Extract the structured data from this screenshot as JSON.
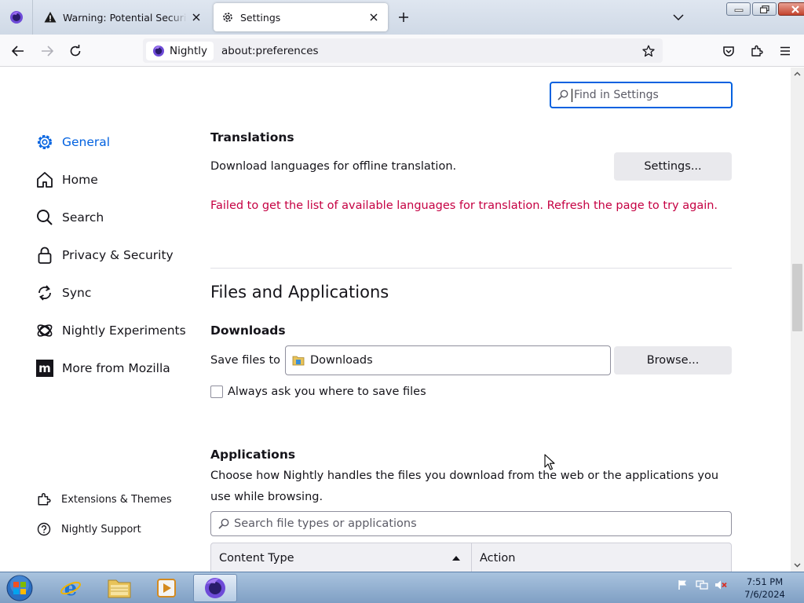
{
  "tabs": [
    {
      "title": "Warning: Potential Security Risk Ahead",
      "icon": "warning-icon"
    },
    {
      "title": "Settings",
      "icon": "gear-icon"
    }
  ],
  "navbar": {
    "identity_label": "Nightly",
    "url": "about:preferences"
  },
  "search": {
    "placeholder": "Find in Settings"
  },
  "sidebar": {
    "items": [
      {
        "label": "General",
        "icon": "gear-icon",
        "selected": true
      },
      {
        "label": "Home",
        "icon": "home-icon"
      },
      {
        "label": "Search",
        "icon": "search-icon"
      },
      {
        "label": "Privacy & Security",
        "icon": "lock-icon"
      },
      {
        "label": "Sync",
        "icon": "sync-icon"
      },
      {
        "label": "Nightly Experiments",
        "icon": "experiments-icon"
      },
      {
        "label": "More from Mozilla",
        "icon": "mozilla-icon"
      }
    ],
    "footer": [
      {
        "label": "Extensions & Themes",
        "icon": "puzzle-icon"
      },
      {
        "label": "Nightly Support",
        "icon": "help-icon"
      }
    ]
  },
  "translations": {
    "heading": "Translations",
    "description": "Download languages for offline translation.",
    "settings_button": "Settings...",
    "error": "Failed to get the list of available languages for translation. Refresh the page to try again."
  },
  "files_apps": {
    "heading": "Files and Applications",
    "downloads": {
      "heading": "Downloads",
      "save_label": "Save files to",
      "folder": "Downloads",
      "browse_button": "Browse...",
      "always_ask": "Always ask you where to save files",
      "always_ask_checked": false
    },
    "applications": {
      "heading": "Applications",
      "description": "Choose how Nightly handles the files you download from the web or the applications you use while browsing.",
      "search_placeholder": "Search file types or applications",
      "columns": [
        "Content Type",
        "Action"
      ]
    }
  },
  "taskbar": {
    "time": "7:51 PM",
    "date": "7/6/2024"
  },
  "colors": {
    "accent": "#0061e0",
    "error": "#c50042"
  }
}
